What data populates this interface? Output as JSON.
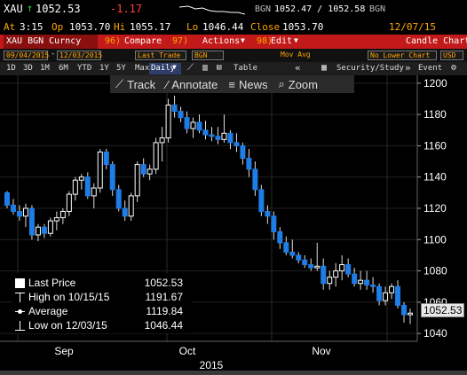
{
  "quote": {
    "ticker": "XAU",
    "last": "1052.53",
    "change": "-1.17",
    "source": "BGN",
    "bid_ask": "1052.47 / 1052.58",
    "source2": "BGN",
    "at_label": "At",
    "time": "3:15",
    "op_label": "Op",
    "open": "1053.70",
    "hi_label": "Hi",
    "high": "1055.17",
    "lo_label": "Lo",
    "low": "1046.44",
    "close_label": "Close",
    "close": "1053.70",
    "date": "12/07/15"
  },
  "toolbar": {
    "security": "XAU BGN Curncy",
    "compare_num": "96)",
    "compare": "Compare",
    "actions_num": "97)",
    "actions": "Actions",
    "edit_num": "98)",
    "edit": "Edit",
    "chart_type": "Candle Chart"
  },
  "settings": {
    "start_date": "09/04/2015",
    "end_date": "12/03/2015",
    "price_field": "Last Trade",
    "source_field": "BGN",
    "indicator": "Mov Avg",
    "lower_chart": "No Lower Chart",
    "currency": "USD"
  },
  "periods": [
    "1D",
    "3D",
    "1M",
    "6M",
    "YTD",
    "1Y",
    "5Y",
    "Max"
  ],
  "frequency": "Daily",
  "table_label": "Table",
  "security_study": "Security/Study",
  "event_label": "Event",
  "tools": {
    "track": "Track",
    "annotate": "Annotate",
    "news": "News",
    "zoom": "Zoom"
  },
  "legend": {
    "last_label": "Last Price",
    "last_value": "1052.53",
    "high_label": "High on 10/15/15",
    "high_value": "1191.67",
    "avg_label": "Average",
    "avg_value": "1119.84",
    "low_label": "Low on 12/03/15",
    "low_value": "1046.44"
  },
  "x_axis": {
    "months": [
      "Sep",
      "Oct",
      "Nov"
    ],
    "year": "2015"
  },
  "colors": {
    "up": "#ffffff",
    "down": "#1e7de6",
    "toolbar_red": "#c21a1a",
    "orange": "#ffa500"
  },
  "chart_data": {
    "type": "candlestick",
    "ylim": [
      1035,
      1205
    ],
    "yticks": [
      1040,
      1060,
      1080,
      1100,
      1120,
      1140,
      1160,
      1180,
      1200
    ],
    "last_marker": "1052.53",
    "candles": [
      [
        1130,
        1131,
        1120,
        1122
      ],
      [
        1122,
        1126,
        1116,
        1118
      ],
      [
        1118,
        1122,
        1112,
        1115
      ],
      [
        1115,
        1123,
        1108,
        1120
      ],
      [
        1120,
        1122,
        1100,
        1103
      ],
      [
        1103,
        1110,
        1099,
        1108
      ],
      [
        1108,
        1110,
        1101,
        1104
      ],
      [
        1104,
        1114,
        1102,
        1112
      ],
      [
        1112,
        1118,
        1106,
        1114
      ],
      [
        1114,
        1120,
        1110,
        1118
      ],
      [
        1118,
        1131,
        1115,
        1129
      ],
      [
        1129,
        1140,
        1125,
        1138
      ],
      [
        1138,
        1142,
        1132,
        1140
      ],
      [
        1140,
        1143,
        1126,
        1128
      ],
      [
        1128,
        1136,
        1120,
        1133
      ],
      [
        1133,
        1158,
        1130,
        1156
      ],
      [
        1156,
        1158,
        1145,
        1148
      ],
      [
        1148,
        1150,
        1128,
        1132
      ],
      [
        1132,
        1135,
        1118,
        1120
      ],
      [
        1120,
        1125,
        1112,
        1115
      ],
      [
        1115,
        1130,
        1112,
        1128
      ],
      [
        1128,
        1150,
        1124,
        1148
      ],
      [
        1148,
        1152,
        1140,
        1142
      ],
      [
        1142,
        1148,
        1138,
        1145
      ],
      [
        1145,
        1165,
        1142,
        1162
      ],
      [
        1162,
        1172,
        1150,
        1165
      ],
      [
        1165,
        1190,
        1162,
        1186
      ],
      [
        1186,
        1192,
        1178,
        1182
      ],
      [
        1182,
        1185,
        1175,
        1178
      ],
      [
        1178,
        1182,
        1168,
        1171
      ],
      [
        1171,
        1178,
        1165,
        1175
      ],
      [
        1175,
        1180,
        1168,
        1170
      ],
      [
        1170,
        1176,
        1164,
        1167
      ],
      [
        1167,
        1172,
        1163,
        1166
      ],
      [
        1166,
        1172,
        1161,
        1164
      ],
      [
        1164,
        1180,
        1162,
        1168
      ],
      [
        1168,
        1170,
        1158,
        1162
      ],
      [
        1162,
        1168,
        1156,
        1160
      ],
      [
        1160,
        1162,
        1148,
        1152
      ],
      [
        1152,
        1158,
        1140,
        1145
      ],
      [
        1145,
        1150,
        1128,
        1132
      ],
      [
        1132,
        1135,
        1115,
        1118
      ],
      [
        1118,
        1122,
        1110,
        1115
      ],
      [
        1115,
        1118,
        1100,
        1105
      ],
      [
        1105,
        1108,
        1094,
        1098
      ],
      [
        1098,
        1102,
        1090,
        1092
      ],
      [
        1092,
        1100,
        1088,
        1090
      ],
      [
        1090,
        1092,
        1085,
        1087
      ],
      [
        1087,
        1090,
        1082,
        1084
      ],
      [
        1084,
        1088,
        1080,
        1082
      ],
      [
        1082,
        1098,
        1080,
        1083
      ],
      [
        1083,
        1088,
        1068,
        1072
      ],
      [
        1072,
        1080,
        1068,
        1076
      ],
      [
        1076,
        1085,
        1070,
        1080
      ],
      [
        1080,
        1090,
        1074,
        1084
      ],
      [
        1084,
        1088,
        1076,
        1078
      ],
      [
        1078,
        1082,
        1070,
        1072
      ],
      [
        1072,
        1080,
        1068,
        1074
      ],
      [
        1074,
        1080,
        1068,
        1071
      ],
      [
        1071,
        1076,
        1066,
        1070
      ],
      [
        1070,
        1072,
        1058,
        1061
      ],
      [
        1061,
        1070,
        1058,
        1066
      ],
      [
        1066,
        1072,
        1062,
        1070
      ],
      [
        1070,
        1074,
        1056,
        1058
      ],
      [
        1058,
        1060,
        1047,
        1052
      ],
      [
        1052,
        1056,
        1046,
        1053
      ]
    ]
  }
}
